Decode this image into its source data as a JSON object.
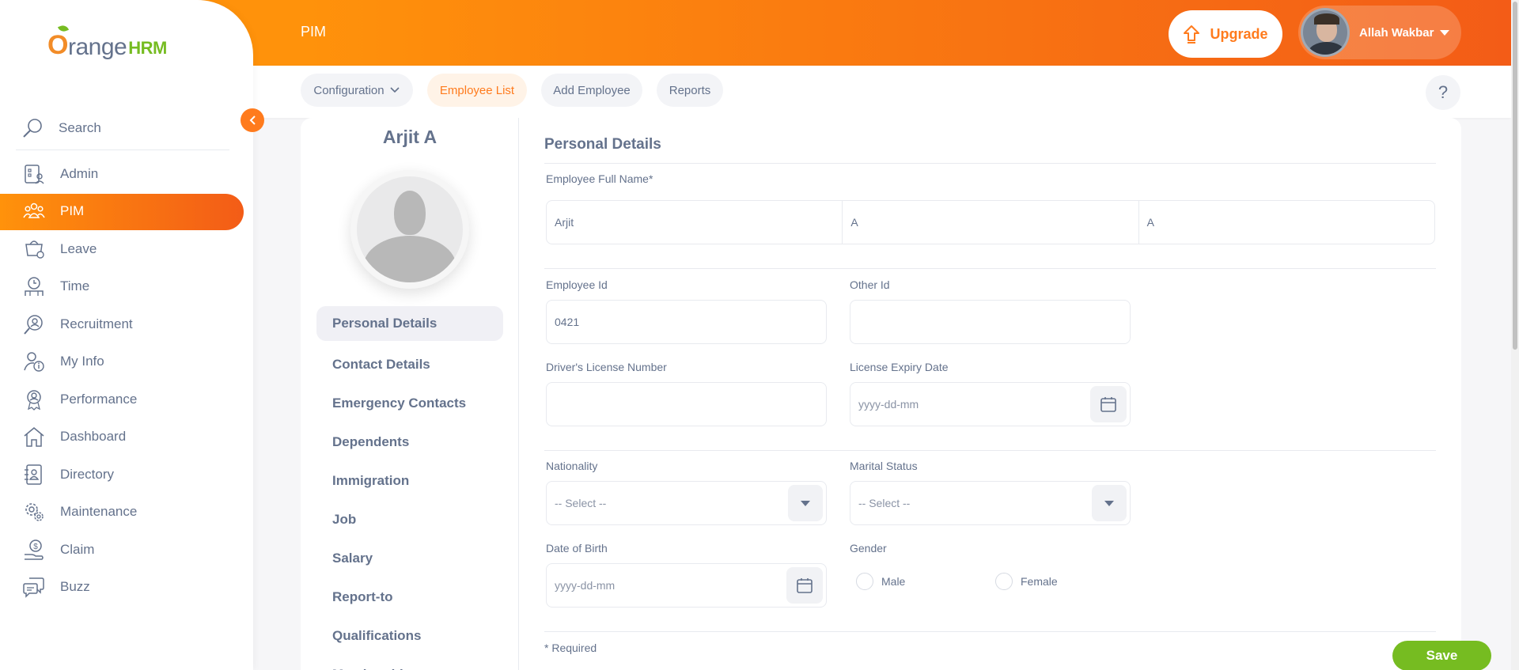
{
  "brand": {
    "logo_o": "O",
    "logo_range": "range",
    "logo_hrm": "HRM"
  },
  "header": {
    "title": "PIM",
    "upgrade_label": "Upgrade",
    "user_name": "Allah Wakbar"
  },
  "sidebar": {
    "search_label": "Search",
    "items": [
      {
        "label": "Admin",
        "icon": "admin-icon"
      },
      {
        "label": "PIM",
        "icon": "pim-icon",
        "active": true
      },
      {
        "label": "Leave",
        "icon": "leave-icon"
      },
      {
        "label": "Time",
        "icon": "time-icon"
      },
      {
        "label": "Recruitment",
        "icon": "recruitment-icon"
      },
      {
        "label": "My Info",
        "icon": "my-info-icon"
      },
      {
        "label": "Performance",
        "icon": "performance-icon"
      },
      {
        "label": "Dashboard",
        "icon": "dashboard-icon"
      },
      {
        "label": "Directory",
        "icon": "directory-icon"
      },
      {
        "label": "Maintenance",
        "icon": "maintenance-icon"
      },
      {
        "label": "Claim",
        "icon": "claim-icon"
      },
      {
        "label": "Buzz",
        "icon": "buzz-icon"
      }
    ]
  },
  "subnav": {
    "configuration": "Configuration",
    "employee_list": "Employee List",
    "add_employee": "Add Employee",
    "reports": "Reports",
    "help": "?"
  },
  "employee": {
    "name": "Arjit A"
  },
  "side_menu": [
    "Personal Details",
    "Contact Details",
    "Emergency Contacts",
    "Dependents",
    "Immigration",
    "Job",
    "Salary",
    "Report-to",
    "Qualifications",
    "Memberships"
  ],
  "form": {
    "section_title": "Personal Details",
    "full_name_label": "Employee Full Name*",
    "first_name": "Arjit",
    "middle_name": "A",
    "last_name": "A",
    "employee_id_label": "Employee Id",
    "employee_id": "0421",
    "other_id_label": "Other Id",
    "other_id": "",
    "license_label": "Driver's License Number",
    "license_value": "",
    "license_expiry_label": "License Expiry Date",
    "license_expiry_placeholder": "yyyy-dd-mm",
    "nationality_label": "Nationality",
    "nationality_value": "-- Select --",
    "marital_label": "Marital Status",
    "marital_value": "-- Select --",
    "dob_label": "Date of Birth",
    "dob_placeholder": "yyyy-dd-mm",
    "gender_label": "Gender",
    "gender_male": "Male",
    "gender_female": "Female",
    "required_note": "* Required",
    "save_label": "Save"
  },
  "colors": {
    "accent": "#ff7b1d",
    "save_green": "#76bc21",
    "text": "#64728c"
  }
}
